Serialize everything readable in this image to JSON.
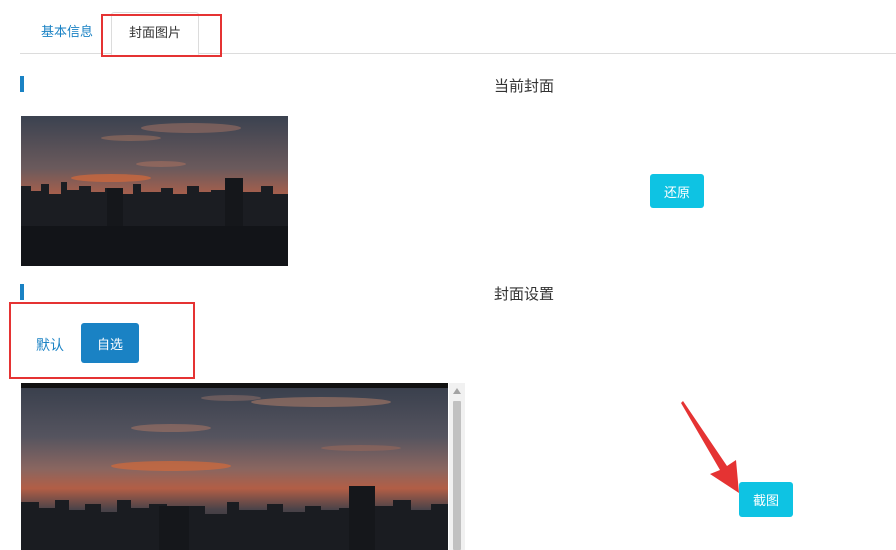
{
  "tabs": {
    "basic_info": "基本信息",
    "cover_image": "封面图片"
  },
  "current_cover": {
    "title": "当前封面",
    "restore_label": "还原"
  },
  "cover_settings": {
    "title": "封面设置",
    "default_label": "默认",
    "custom_label": "自选",
    "crop_label": "截图"
  },
  "colors": {
    "accent_blue": "#1a82c4",
    "button_cyan": "#0ec3e3",
    "annotation_red": "#e53333"
  }
}
